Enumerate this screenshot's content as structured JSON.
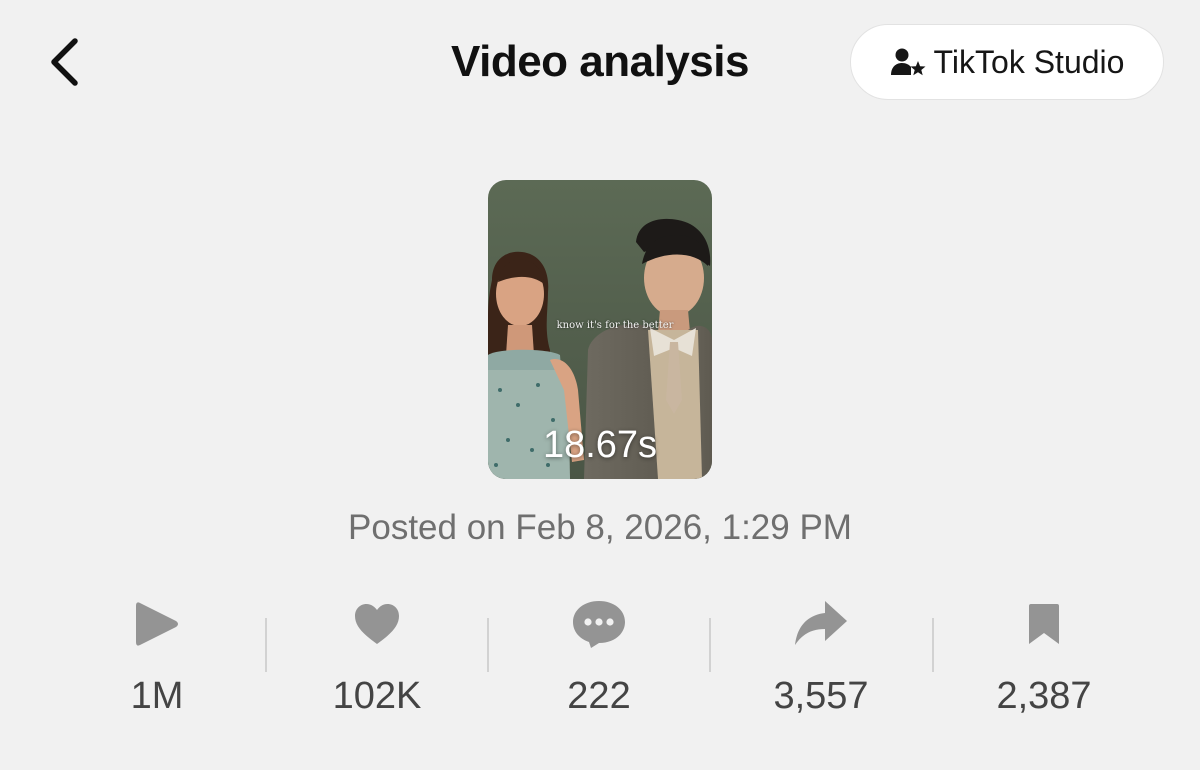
{
  "header": {
    "title": "Video analysis",
    "studio_button_label": "TikTok Studio"
  },
  "video": {
    "caption": "know it's for the better",
    "duration": "18.67s",
    "posted": "Posted on Feb 8, 2026, 1:29 PM"
  },
  "stats": {
    "views": "1M",
    "likes": "102K",
    "comments": "222",
    "shares": "3,557",
    "saves": "2,387"
  },
  "colors": {
    "background": "#f1f1f1",
    "icon_gray": "#949494",
    "text_dark": "#111111",
    "text_muted": "#6f6f6f"
  },
  "icons": [
    "chevron-left-icon",
    "user-star-icon",
    "play-icon",
    "heart-icon",
    "comment-icon",
    "share-icon",
    "bookmark-icon"
  ]
}
